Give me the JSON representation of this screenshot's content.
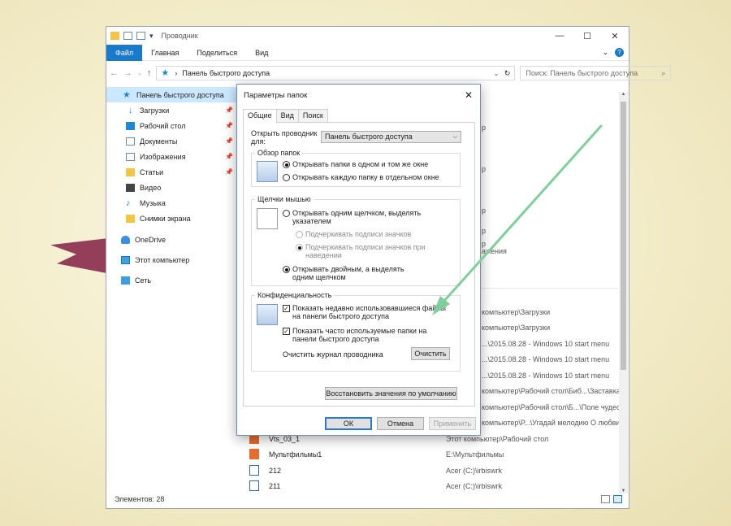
{
  "explorer": {
    "title": "Проводник",
    "ribbon_tabs": [
      "Файл",
      "Главная",
      "Поделиться",
      "Вид"
    ],
    "address": "Панель быстрого доступа",
    "search_placeholder": "Поиск: Панель быстрого доступа",
    "nav": {
      "quick_access": "Панель быстрого доступа",
      "items": [
        "Загрузки",
        "Рабочий стол",
        "Документы",
        "Изображения",
        "Статьи",
        "Видео",
        "Музыка",
        "Снимки экрана"
      ],
      "onedrive": "OneDrive",
      "this_pc": "Этот компьютер",
      "network": "Сеть"
    },
    "fragments": [
      "р",
      "р",
      "р",
      "р",
      "р",
      "ажения"
    ],
    "file_paths": [
      "компьютер\\Загрузки",
      "компьютер\\Загрузки",
      "...\\2015.08.28 - Windows 10 start menu",
      "...\\2015.08.28 - Windows 10 start menu",
      "...\\2015.08.28 - Windows 10 start menu",
      "компьютер\\Рабочий стол\\Биб...\\Заставка",
      "компьютер\\Рабочий стол\\Б...\\Поле чудес",
      "компьютер\\Р...\\Угадай мелодию О любви"
    ],
    "files": [
      {
        "name": "Vts_03_1",
        "path": "Этот компьютер\\Рабочий стол"
      },
      {
        "name": "Мультфильмы1",
        "path": "E:\\Мультфильмы"
      },
      {
        "name": "212",
        "path": "Acer (C:)\\irbiswrk"
      },
      {
        "name": "211",
        "path": "Acer (C:)\\irbiswrk"
      }
    ],
    "status": "Элементов: 28"
  },
  "dialog": {
    "title": "Параметры папок",
    "tabs": [
      "Общие",
      "Вид",
      "Поиск"
    ],
    "open_label": "Открыть проводник для:",
    "open_value": "Панель быстрого доступа",
    "browse_group": "Обзор папок",
    "browse_same": "Открывать папки в одном и том же окне",
    "browse_new": "Открывать каждую папку в отдельном окне",
    "click_group": "Щелчки мышью",
    "single_click": "Открывать одним щелчком, выделять указателем",
    "underline_always": "Подчеркивать подписи значков",
    "underline_hover": "Подчеркивать подписи значков при наведении",
    "double_click": "Открывать двойным, а выделять одним щелчком",
    "privacy_group": "Конфиденциальность",
    "show_recent": "Показать недавно использовавшиеся файлы на панели быстрого доступа",
    "show_frequent": "Показать часто используемые папки на панели быстрого доступа",
    "clear_label": "Очистить журнал проводника",
    "clear_button": "Очистить",
    "restore_button": "Восстановить значения по умолчанию",
    "ok": "ОК",
    "cancel": "Отмена",
    "apply": "Применить"
  },
  "colors": {
    "accent": "#1979ca",
    "arrow": "#7fcf9c",
    "selection": "#cce8ff"
  }
}
